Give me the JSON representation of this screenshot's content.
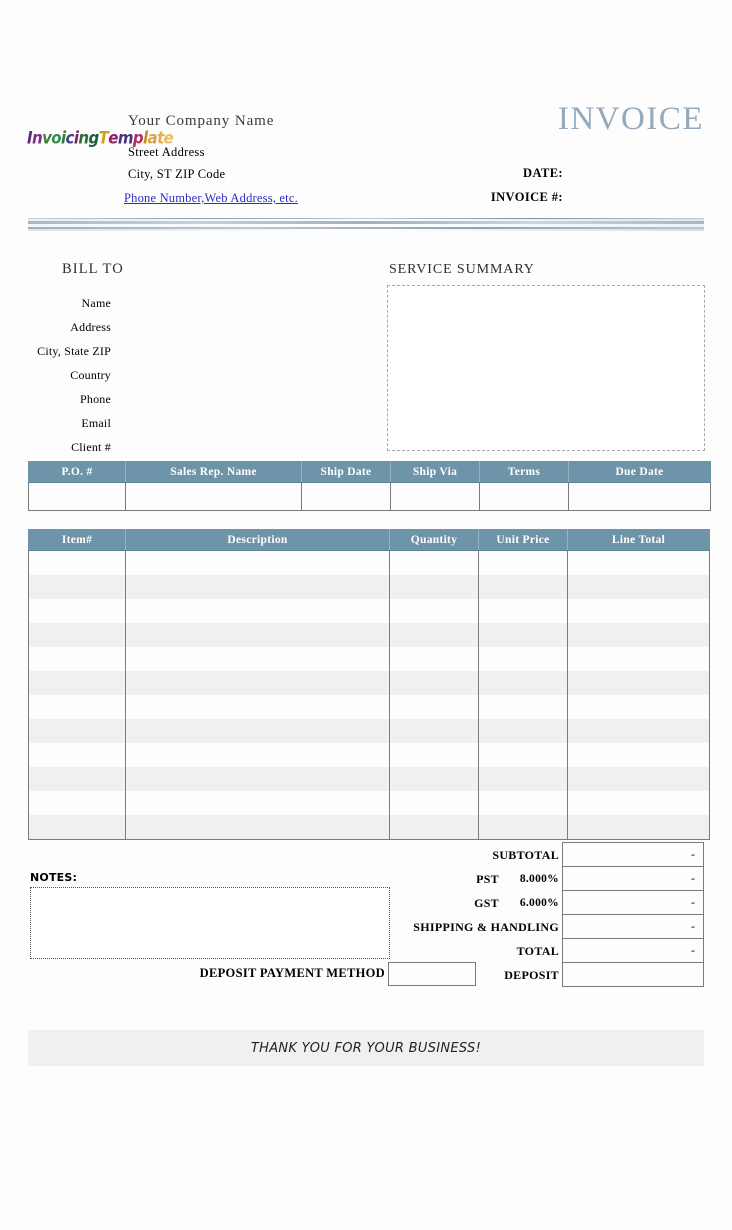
{
  "document": {
    "title": "INVOICE",
    "accent_color": "#6d94a8",
    "title_color": "#95a9ba",
    "stripe_color": "#f0f0f0"
  },
  "company": {
    "logo_text": "InvoicingTemplate",
    "logo_letters": [
      {
        "ch": "I",
        "color": "#5b2b7a"
      },
      {
        "ch": "n",
        "color": "#7b2d8e"
      },
      {
        "ch": "v",
        "color": "#3f7f3f"
      },
      {
        "ch": "o",
        "color": "#2f8f4f"
      },
      {
        "ch": "i",
        "color": "#2e7d32"
      },
      {
        "ch": "c",
        "color": "#4b3f8f"
      },
      {
        "ch": "i",
        "color": "#7a1f5a"
      },
      {
        "ch": "n",
        "color": "#2e6b3a"
      },
      {
        "ch": "g",
        "color": "#1f5e3a"
      },
      {
        "ch": "T",
        "color": "#d4a017"
      },
      {
        "ch": "e",
        "color": "#8a1f6a"
      },
      {
        "ch": "m",
        "color": "#4a2f7a"
      },
      {
        "ch": "p",
        "color": "#b03060"
      },
      {
        "ch": "l",
        "color": "#c98a2a"
      },
      {
        "ch": "a",
        "color": "#d9a441"
      },
      {
        "ch": "t",
        "color": "#e0b050"
      },
      {
        "ch": "e",
        "color": "#e8c060"
      }
    ],
    "name": "Your Company Name",
    "street": "Street Address",
    "city_state_zip": "City, ST  ZIP Code",
    "contact_link": "Phone Number,Web Address, etc."
  },
  "meta": {
    "date_label": "DATE:",
    "date_value": "",
    "invoice_no_label": "INVOICE #:",
    "invoice_no_value": ""
  },
  "bill_to": {
    "title": "BILL TO",
    "labels": [
      "Name",
      "Address",
      "City, State ZIP",
      "Country",
      "Phone",
      "Email",
      "Client #"
    ]
  },
  "service_summary": {
    "title": "SERVICE SUMMARY",
    "value": ""
  },
  "po_table": {
    "headers": [
      "P.O. #",
      "Sales Rep. Name",
      "Ship Date",
      "Ship Via",
      "Terms",
      "Due Date"
    ],
    "row": [
      "",
      "",
      "",
      "",
      "",
      ""
    ]
  },
  "items_table": {
    "headers": [
      "Item#",
      "Description",
      "Quantity",
      "Unit Price",
      "Line Total"
    ],
    "rows": [
      [
        "",
        "",
        "",
        "",
        ""
      ],
      [
        "",
        "",
        "",
        "",
        ""
      ],
      [
        "",
        "",
        "",
        "",
        ""
      ],
      [
        "",
        "",
        "",
        "",
        ""
      ],
      [
        "",
        "",
        "",
        "",
        ""
      ],
      [
        "",
        "",
        "",
        "",
        ""
      ],
      [
        "",
        "",
        "",
        "",
        ""
      ],
      [
        "",
        "",
        "",
        "",
        ""
      ],
      [
        "",
        "",
        "",
        "",
        ""
      ],
      [
        "",
        "",
        "",
        "",
        ""
      ],
      [
        "",
        "",
        "",
        "",
        ""
      ],
      [
        "",
        "",
        "",
        "",
        ""
      ]
    ]
  },
  "totals": {
    "subtotal_label": "SUBTOTAL",
    "subtotal_value": "-",
    "pst_label": "PST",
    "pst_rate": "8.000%",
    "pst_value": "-",
    "gst_label": "GST",
    "gst_rate": "6.000%",
    "gst_value": "-",
    "shipping_label": "SHIPPING & HANDLING",
    "shipping_value": "-",
    "total_label": "TOTAL",
    "total_value": "-",
    "deposit_label": "DEPOSIT",
    "deposit_value": ""
  },
  "notes": {
    "label": "NOTES:",
    "value": ""
  },
  "deposit_payment": {
    "label": "DEPOSIT PAYMENT METHOD",
    "value": ""
  },
  "footer": {
    "message": "THANK YOU FOR YOUR BUSINESS!"
  }
}
